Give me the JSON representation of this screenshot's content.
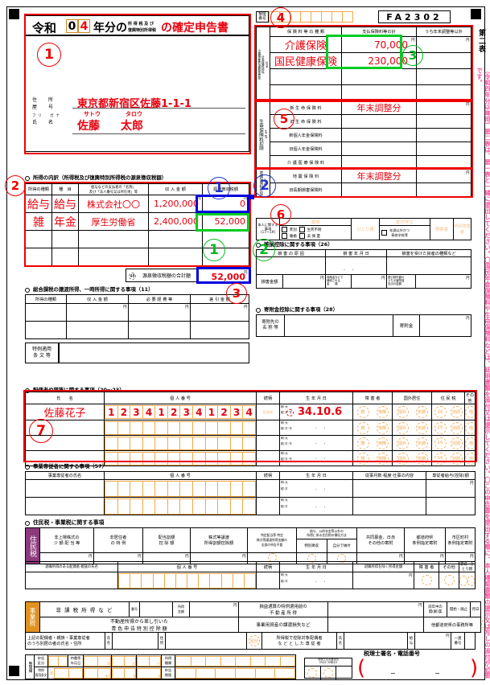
{
  "form": {
    "form_code": "FA2302",
    "title_prefix": "令和",
    "year_digits": [
      "0",
      "4"
    ],
    "title_mid": "年分の",
    "title_ruby_top": "所 得 税 及 び",
    "title_ruby_bottom": "復興特別所得税",
    "title_suffix": "の確定申告書",
    "sheet_label": "第二表",
    "seiri_label": "整理\n番号",
    "right_margin_note": "（令和四年分以降用）第二表は、第一表と一緒に提出してください。〇国民年金保険料や生命保険料などは、証明書類を添付又は提示してください。〇この申告書を提出する際に、本人確認書類の提示又は写しの添付が必要です。"
  },
  "taxpayer": {
    "address_label_1": "住　所",
    "address_label_2": "屋　号",
    "furigana_label": "フリ　ガナ",
    "name_label": "氏　名",
    "address": "東京都新宿区佐藤1-1-1",
    "furigana_last": "サトウ",
    "furigana_first": "タロウ",
    "name_last": "佐藤",
    "name_first": "太郎"
  },
  "income_detail": {
    "section_title": "所得の内訳（所得税及び復興特別所得税の源泉徴収税額）",
    "headers": [
      "所得の種類",
      "種　目",
      "給与などの支払者の「名称」\n及び「法人番号又は所在地」等",
      "収 入 金 額",
      "源泉徴収税額"
    ],
    "yen_mark": "円",
    "rows": [
      {
        "kind": "給与",
        "item": "給与",
        "payer": "株式会社〇〇",
        "amount": "1,200,000",
        "withheld": "0"
      },
      {
        "kind": "雑",
        "item": "年金",
        "payer": "厚生労働省",
        "amount": "2,400,000",
        "withheld": "52,000"
      },
      {
        "kind": "",
        "item": "",
        "payer": "",
        "amount": "",
        "withheld": ""
      },
      {
        "kind": "",
        "item": "",
        "payer": "",
        "amount": "",
        "withheld": ""
      }
    ],
    "total_label": "源泉徴収税額の合計額",
    "total_mark": "48",
    "total_value": "52,000"
  },
  "transfer_income": {
    "section_title": "総合課税の譲渡所得、一時所得に関する事項（11）",
    "headers": [
      "所得の種類",
      "収 入 金 額",
      "必 要 経 費 等",
      "差 引 金 額"
    ],
    "yen_mark": "円"
  },
  "special_clause": {
    "label": "特例適用\n条 文 等",
    "value": ""
  },
  "social_insurance": {
    "col_headers": [
      "保 険 料 等 の 種 類",
      "支払保険料等の計",
      "うち年末調整等以外"
    ],
    "side_label": "13 04\n社会保険料控除\n小規模企業共済等掛金控除",
    "yen_mark": "円",
    "rows": [
      {
        "kind": "介護保険",
        "paid": "70,000",
        "other": ""
      },
      {
        "kind": "国民健康保険",
        "paid": "230,000",
        "other": ""
      },
      {
        "kind": "",
        "paid": "",
        "other": ""
      },
      {
        "kind": "",
        "paid": "",
        "other": ""
      }
    ]
  },
  "life_insurance": {
    "side_label": "15\n生命保険料控除",
    "yen_mark": "円",
    "rows": [
      {
        "kind": "新 生 命 保 険 料",
        "paid": "年末調整分",
        "other": ""
      },
      {
        "kind": "旧 生 命 保 険 料",
        "paid": "",
        "other": ""
      },
      {
        "kind": "新個人年金保険料",
        "paid": "",
        "other": ""
      },
      {
        "kind": "旧個人年金保険料",
        "paid": "",
        "other": ""
      },
      {
        "kind": "介 護 医 療 保 険 料",
        "paid": "",
        "other": ""
      }
    ]
  },
  "quake_insurance": {
    "side_label": "16\n地震保険料控除",
    "yen_mark": "円",
    "rows": [
      {
        "kind": "地 震 保 険 料",
        "paid": "年末調整分",
        "other": ""
      },
      {
        "kind": "旧長期損害保険料",
        "paid": "",
        "other": ""
      }
    ]
  },
  "personal_matters": {
    "side_label": "本人に関する事項\n(17〜19)",
    "groups": [
      {
        "title": "寡婦",
        "options": [
          "死別",
          "生死不明",
          "離婚",
          "未 帰 還"
        ]
      },
      {
        "title": "ひとり親",
        "options": []
      },
      {
        "title": "勤労学生",
        "options": [
          "年調以外かつ\n専修学校等"
        ]
      },
      {
        "title": "障害者",
        "options": []
      },
      {
        "title": "特別障害者",
        "options": []
      }
    ]
  },
  "casualty": {
    "section_title": "雑損控除に関する事項（26）",
    "headers": [
      "損 害 の 原 因",
      "損 害 年 月 日",
      "損害を受けた資産の種類など"
    ],
    "amount_label": "損害金額",
    "insured_label": "保険金などで\n補填される\n金　　額",
    "deduct_label": "差引損失額の\nうち災害関連\n支出の金額",
    "yen_mark": "円"
  },
  "donation": {
    "section_title": "寄附金控除に関する事項（28）",
    "name_label": "寄附先の\n名 称 等",
    "amount_label": "寄附金",
    "yen_mark": "円"
  },
  "dependents": {
    "section_title": "配偶者や親族に関する事項（20〜23）",
    "headers": [
      "氏　　名",
      "個 人 番 号",
      "続柄",
      "生 年 月 日",
      "障 害 者",
      "国外居住",
      "住 民 税",
      "その他"
    ],
    "era_line_1": "明·大",
    "era_line_2": "昭·平·令",
    "rows": [
      {
        "name": "佐藤花子",
        "mynumber": [
          "1",
          "2",
          "3",
          "4",
          "1",
          "2",
          "3",
          "4",
          "1",
          "2",
          "3",
          "4"
        ],
        "relation": "配偶者",
        "birth": "34.10.6",
        "badges": [
          "障",
          "特障",
          "国外",
          "年調",
          "16",
          "別居",
          "他"
        ]
      },
      {
        "name": "",
        "mynumber": [
          "",
          "",
          "",
          "",
          "",
          "",
          "",
          "",
          "",
          "",
          "",
          ""
        ],
        "relation": "",
        "birth": "",
        "badges": [
          "障",
          "特障",
          "国外",
          "年調",
          "16",
          "別居",
          "他"
        ]
      },
      {
        "name": "",
        "mynumber": [
          "",
          "",
          "",
          "",
          "",
          "",
          "",
          "",
          "",
          "",
          "",
          ""
        ],
        "relation": "",
        "birth": "",
        "badges": [
          "障",
          "特障",
          "国外",
          "年調",
          "16",
          "別居",
          "他"
        ]
      },
      {
        "name": "",
        "mynumber": [
          "",
          "",
          "",
          "",
          "",
          "",
          "",
          "",
          "",
          "",
          "",
          ""
        ],
        "relation": "",
        "birth": "",
        "badges": [
          "障",
          "特障",
          "国外",
          "年調",
          "16",
          "別居",
          "他"
        ]
      }
    ]
  },
  "business_employee": {
    "section_title": "事業専従者に関する事項（57）",
    "headers": [
      "事業専従者の氏名",
      "個 人 番 号",
      "続柄",
      "生 年 月 日",
      "従事月数·程度·仕事の内容",
      "専従者給与(控除)額"
    ],
    "yen_mark": "円",
    "era_line_1": "明·大",
    "era_line_2": "昭·平"
  },
  "resident_tax": {
    "section_title": "住民税・事業税に関する事項",
    "side_label": "住民税",
    "headers": [
      "非上場株式の\n少 額 配 当 等",
      "非居住者\nの 特 例",
      "配当割額\n控 除 額",
      "株式等譲渡\n所得割額控除額",
      "特定配当等·特定\n株式等譲渡所得金額の\n全部の申告不要",
      "給与、公的年金等以外の\n所得に係る住民税の徴収方法",
      "共同募金、日赤\nその他の寄附",
      "都道府県\n条例指定寄附",
      "市区町村\n条例指定寄附"
    ],
    "collection_methods": [
      "特別徴収",
      "自分で納付"
    ],
    "yen_mark": "円",
    "retire_headers": [
      "退職所得のある配偶者·親族の氏名",
      "個 人 番 号",
      "続柄",
      "生 年 月 日",
      "退職所得を除く所得金額",
      "障 害 者",
      "その他",
      "寡婦・ひとり親"
    ],
    "era_line_1": "明·大",
    "era_line_2": "昭·平"
  },
  "business_tax": {
    "side_label": "事業税",
    "nontax_label": "非 課 税 所 得 な ど",
    "number_label": "番号",
    "income_label": "所得\n金額",
    "real_estate_label": "損益通算の特例適用前の\n不 動 産 所 得",
    "prev_year_label": "前年中の\n開(廃)業",
    "start_stop_label": "開始・廃止",
    "month_day_label": "月日",
    "blue_label": "不動産所得から差し引いた\n青 色 申 告 特 別 控 除 額",
    "transfer_loss_label": "事業用資産の譲渡損失など",
    "other_office_label": "他都道府県の事務所等",
    "yen_mark": "円"
  },
  "separate_living": {
    "label": "上記の配偶者・親族・事業専従者\nのうち別居の者の氏名・住所",
    "name_label": "氏名",
    "address_label": "住所",
    "badge": "別分",
    "employee_label": "所得税で控除対象配偶者\nな ど と し た 専 従 者",
    "emp_name_label": "氏名",
    "salary_label": "給与",
    "unified_label": "一連\n番号",
    "yen_mark": "円"
  },
  "admin": {
    "side_label": "整理欄",
    "declare_label": "申告\n区分",
    "cert_date_label": "特農等\n年月日",
    "income_kind_label": "所得\n種類",
    "special_article_label": "特例\n適用条文",
    "law_label": "法",
    "article_label": "条の",
    "clause_label": "項",
    "item_label": "号",
    "declare_period_label": "申告\n期限",
    "year_label": "年",
    "month_label": "月",
    "day_label": "日",
    "tax_agent_box_label": "税理士法書面提出\n33の2   30条の2",
    "tax_agent_label": "税理士署名・電話番号",
    "dash": "−"
  },
  "annotations": {
    "markers": [
      {
        "id": "1",
        "color": "#ee0000",
        "meaning": "taxpayer-block"
      },
      {
        "id": "2",
        "color": "#ee0000",
        "meaning": "income-detail-block"
      },
      {
        "id": "3",
        "color": "#ee0000",
        "meaning": "withholding-total"
      },
      {
        "id": "4",
        "color": "#ee0000",
        "meaning": "social-insurance-block"
      },
      {
        "id": "5",
        "color": "#ee0000",
        "meaning": "life-insurance-block"
      },
      {
        "id": "6",
        "color": "#ee0000",
        "meaning": "quake-insurance-block"
      },
      {
        "id": "7",
        "color": "#ee0000",
        "meaning": "dependents-block"
      },
      {
        "id": "1",
        "color": "#2233cc",
        "meaning": "revenue-column"
      },
      {
        "id": "2",
        "color": "#2233cc",
        "meaning": "withheld-column"
      },
      {
        "id": "3",
        "color": "#00bb22",
        "meaning": "social-insurance-amounts"
      },
      {
        "id": "1",
        "color": "#00bb22",
        "meaning": "pension-revenue"
      },
      {
        "id": "2",
        "color": "#00bb22",
        "meaning": "pension-withheld"
      }
    ]
  }
}
